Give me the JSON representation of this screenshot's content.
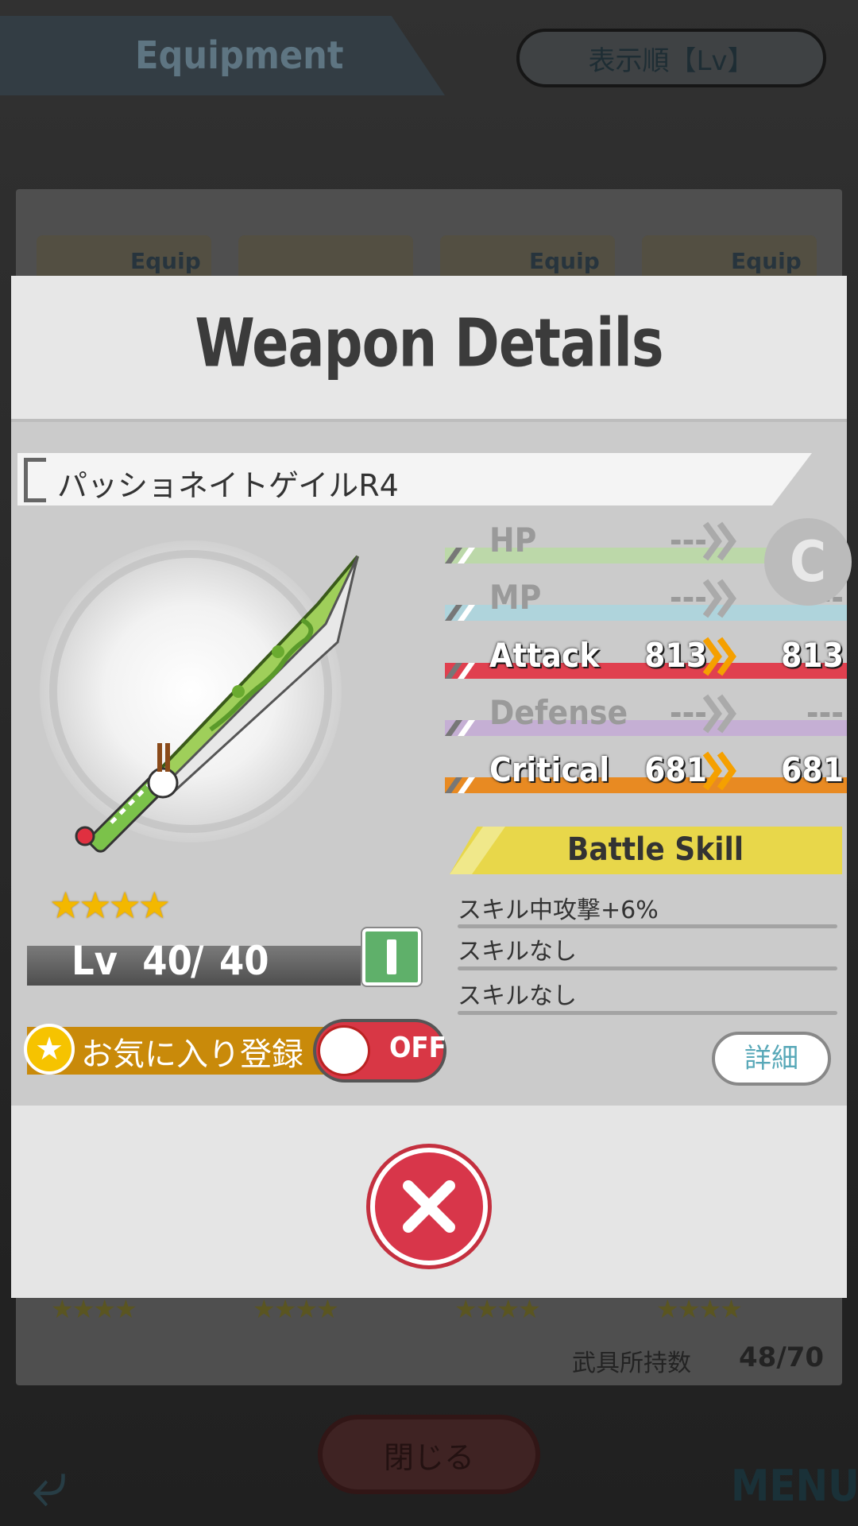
{
  "background": {
    "screen_title": "Equipment",
    "sort_button": "表示順【Lv】",
    "equip_labels": [
      "Equip",
      "Equip",
      "Equip"
    ],
    "stars": [
      "★★★★",
      "★★★★",
      "★★★★",
      "★★★★"
    ],
    "inventory_label": "武具所持数",
    "inventory_count": "48/70",
    "close_button": "閉じる",
    "menu_button": "MENU"
  },
  "dialog": {
    "title": "Weapon Details",
    "weapon_name": "パッショネイトゲイルR4",
    "rarity_stars": "★★★★",
    "level": {
      "label": "Lv",
      "current": "40",
      "separator": "/",
      "max": "40"
    },
    "favorite": {
      "label": "お気に入り登録",
      "toggle_state": "OFF"
    },
    "stats": [
      {
        "name": "HP",
        "value": "---",
        "compare": "---",
        "active": false,
        "color": "#b8dba0"
      },
      {
        "name": "MP",
        "value": "---",
        "compare": "---",
        "active": false,
        "color": "#a8d6e0"
      },
      {
        "name": "Attack",
        "value": "813",
        "compare": "813",
        "active": true,
        "color": "#e0404f"
      },
      {
        "name": "Defense",
        "value": "---",
        "compare": "---",
        "active": false,
        "color": "#c3a7d6"
      },
      {
        "name": "Critical",
        "value": "681",
        "compare": "681",
        "active": true,
        "color": "#e88a22"
      }
    ],
    "compare_badge": "C",
    "battle_skill": {
      "title": "Battle Skill",
      "skills": [
        "スキル中攻撃+6%",
        "スキルなし",
        "スキルなし"
      ]
    },
    "detail_button": "詳細",
    "close_icon": "close-icon"
  }
}
